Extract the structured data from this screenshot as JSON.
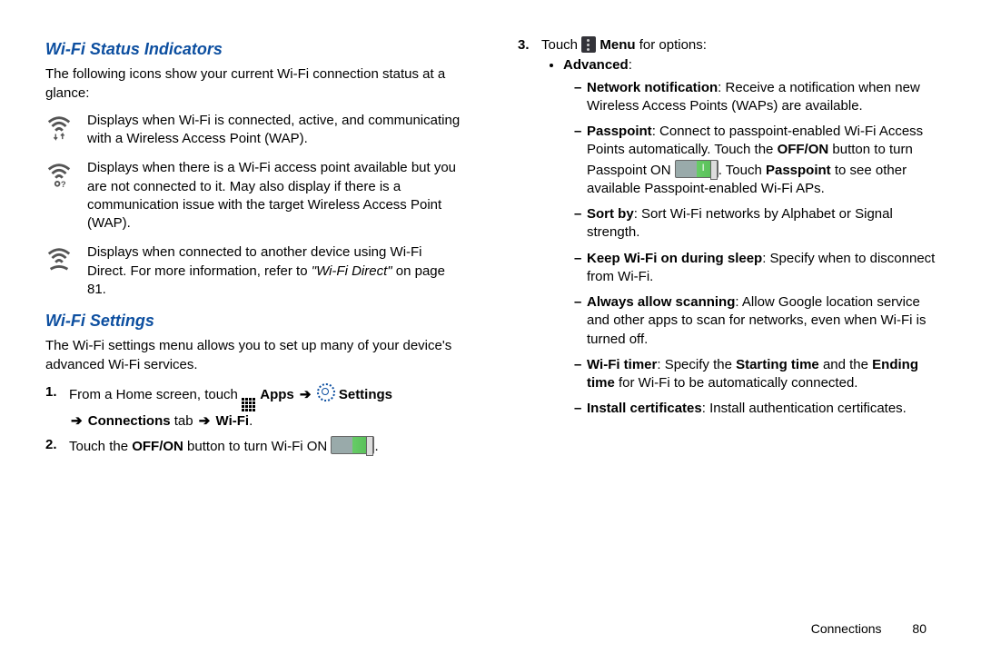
{
  "left": {
    "h1": "Wi-Fi Status Indicators",
    "intro": "The following icons show your current Wi-Fi connection status at a glance:",
    "ind1": "Displays when Wi-Fi is connected, active, and communicating with a Wireless Access Point (WAP).",
    "ind2": "Displays when there is a Wi-Fi access point available but you are not connected to it. May also display if there is a communication issue with the target Wireless Access Point (WAP).",
    "ind3a": "Displays when connected to another device using Wi-Fi Direct. For more information, refer to ",
    "ind3b": "\"Wi-Fi Direct\"",
    "ind3c": " on page 81.",
    "h2": "Wi-Fi Settings",
    "intro2": "The Wi-Fi settings menu allows you to set up many of your device's advanced Wi-Fi services.",
    "step1a": "From a Home screen, touch ",
    "apps": " Apps ",
    "settings": " Settings ",
    "conn": " Connections ",
    "tab": " tab ",
    "wifi": " Wi-Fi",
    "step2a": "Touch the ",
    "offon": "OFF/ON",
    "step2b": " button to turn Wi-Fi ON ",
    "period": "."
  },
  "right": {
    "step3a": "Touch ",
    "menu": " Menu",
    "step3b": " for options:",
    "advanced": "Advanced",
    "nn_b": "Network notification",
    "nn_t": ": Receive a notification when new Wireless Access Points (WAPs) are available.",
    "pp_b": "Passpoint",
    "pp_t1": ": Connect to passpoint-enabled Wi-Fi Access Points automatically. Touch the ",
    "pp_off": "OFF/ON",
    "pp_t2": " button to turn Passpoint ON ",
    "pp_t3": ". Touch ",
    "pp_b2": "Passpoint",
    "pp_t4": " to see other available Passpoint-enabled Wi-Fi APs.",
    "sb_b": "Sort by",
    "sb_t": ": Sort Wi-Fi networks by Alphabet or Signal strength.",
    "ks_b": "Keep Wi-Fi on during sleep",
    "ks_t": ": Specify when to disconnect from Wi-Fi.",
    "as_b": "Always allow scanning",
    "as_t": ": Allow Google location service and other apps to scan for networks, even when Wi-Fi is turned off.",
    "wt_b": "Wi-Fi timer",
    "wt_t1": ": Specify the ",
    "wt_st": "Starting time",
    "wt_t2": " and the ",
    "wt_et": "Ending time",
    "wt_t3": " for Wi-Fi to be automatically connected.",
    "ic_b": "Install certificates",
    "ic_t": ": Install authentication certificates."
  },
  "footer": {
    "section": "Connections",
    "page": "80"
  }
}
